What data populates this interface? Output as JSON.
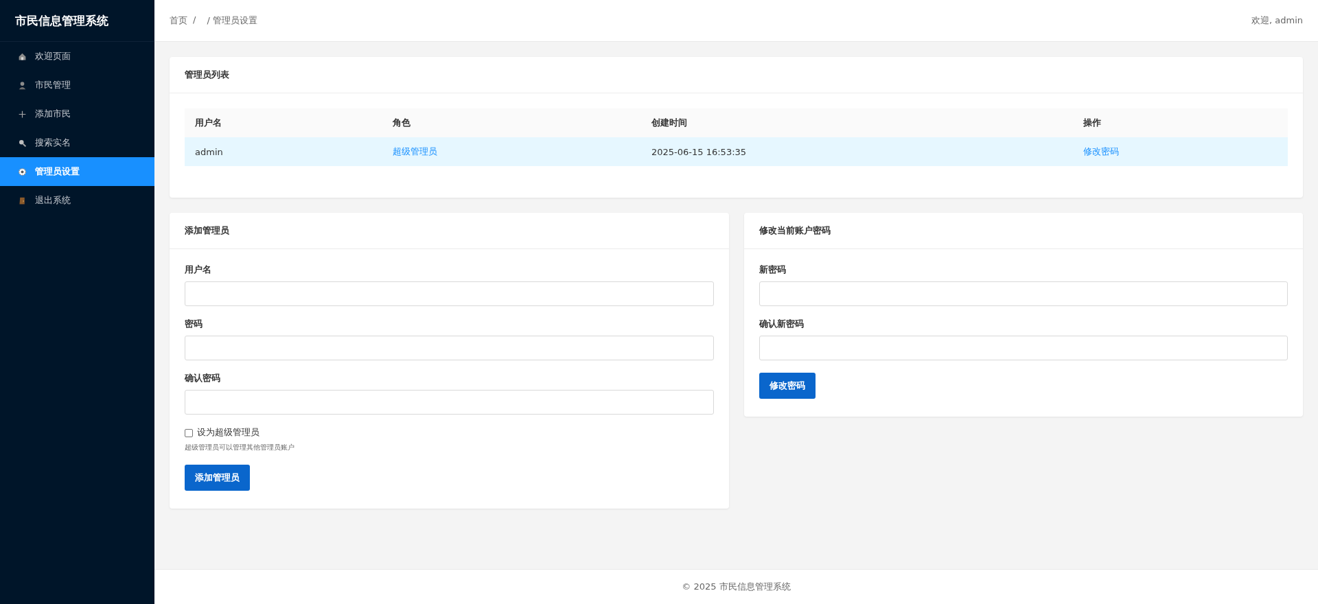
{
  "sidebar": {
    "title": "市民信息管理系统",
    "items": [
      {
        "label": "欢迎页面",
        "kind": "home",
        "selected": false
      },
      {
        "label": "市民管理",
        "kind": "person",
        "selected": false
      },
      {
        "label": "添加市民",
        "kind": "plus",
        "selected": false
      },
      {
        "label": "搜索实名",
        "kind": "search",
        "selected": false
      },
      {
        "label": "管理员设置",
        "kind": "gear",
        "selected": true
      },
      {
        "label": "退出系统",
        "kind": "door",
        "selected": false
      }
    ]
  },
  "header": {
    "breadcrumb": [
      "首页",
      "/",
      "/ 管理员设置"
    ],
    "welcome": "欢迎, admin"
  },
  "admin_list": {
    "title": "管理员列表",
    "columns": [
      "用户名",
      "角色",
      "创建时间",
      "操作"
    ],
    "rows": [
      {
        "username": "admin",
        "role": "超级管理员",
        "created": "2025-06-15 16:53:35",
        "action": "修改密码"
      }
    ]
  },
  "add_admin": {
    "title": "添加管理员",
    "fields": [
      {
        "label": "用户名"
      },
      {
        "label": "密码"
      },
      {
        "label": "确认密码"
      }
    ],
    "checkbox": {
      "label": "设为超级管理员",
      "checked": false
    },
    "hint": "超级管理员可以管理其他管理员账户",
    "button": "添加管理员"
  },
  "change_password": {
    "title": "修改当前账户密码",
    "fields": [
      {
        "label": "新密码"
      },
      {
        "label": "确认新密码"
      }
    ],
    "button": "修改密码"
  },
  "footer": "© 2025 市民信息管理系统"
}
